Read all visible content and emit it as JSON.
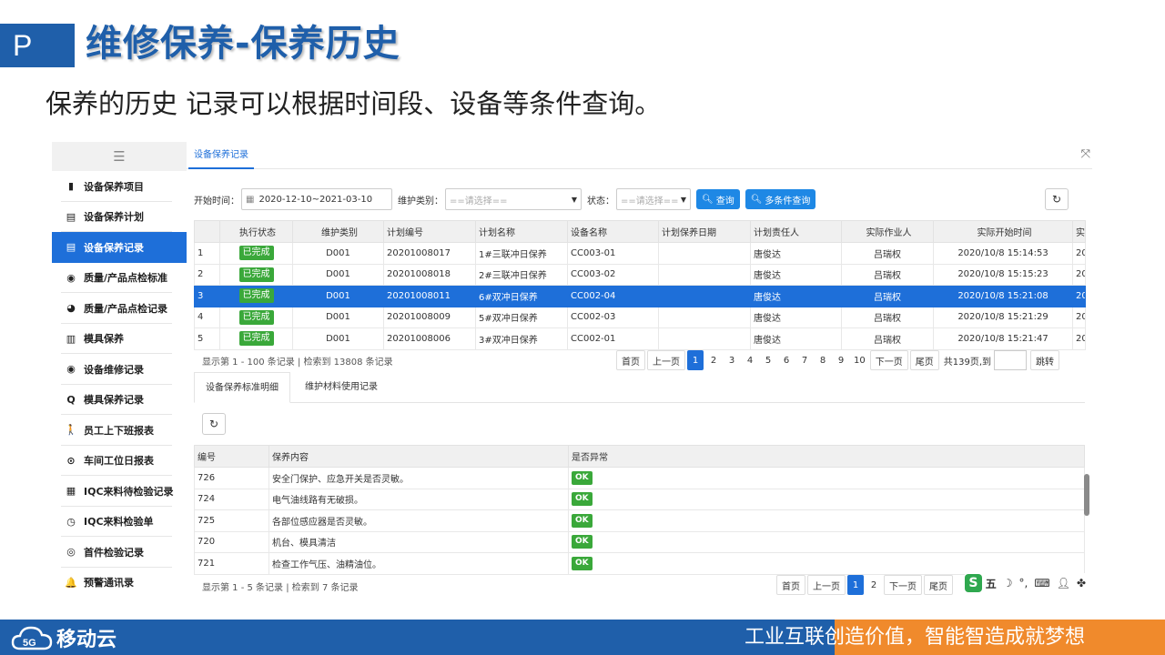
{
  "slide": {
    "badge": "P",
    "title": "维修保养-保养历史",
    "subtitle": "保养的历史 记录可以根据时间段、设备等条件查询。",
    "footer_slogan": "工业互联创造价值，智能智造成就梦想",
    "brand": "移动云",
    "brand_badge": "5G",
    "colors": {
      "primary": "#1f5faa",
      "accent": "#f08a2c",
      "active": "#1e6fd9",
      "success": "#3aa83a"
    }
  },
  "sidebar": {
    "toggle_icon": "menu-collapse-icon",
    "items": [
      {
        "label": "设备保养项目",
        "icon": "clipboard-icon",
        "glyph": "▮"
      },
      {
        "label": "设备保养计划",
        "icon": "id-card-icon",
        "glyph": "▤"
      },
      {
        "label": "设备保养记录",
        "icon": "id-card-icon",
        "glyph": "▤",
        "active": true
      },
      {
        "label": "质量/产品点检标准",
        "icon": "compass-icon",
        "glyph": "◉"
      },
      {
        "label": "质量/产品点检记录",
        "icon": "gauge-icon",
        "glyph": "◕"
      },
      {
        "label": "模具保养",
        "icon": "bar-chart-icon",
        "glyph": "▥"
      },
      {
        "label": "设备维修记录",
        "icon": "compass-icon",
        "glyph": "◉"
      },
      {
        "label": "模具保养记录",
        "icon": "search-icon",
        "glyph": "Q"
      },
      {
        "label": "员工上下班报表",
        "icon": "walking-icon",
        "glyph": "🚶"
      },
      {
        "label": "车间工位日报表",
        "icon": "target-icon",
        "glyph": "⊙"
      },
      {
        "label": "IQC来料待检验记录",
        "icon": "map-icon",
        "glyph": "▦"
      },
      {
        "label": "IQC来料检验单",
        "icon": "clock-icon",
        "glyph": "◷"
      },
      {
        "label": "首件检验记录",
        "icon": "eye-icon",
        "glyph": "◎"
      },
      {
        "label": "预警通讯录",
        "icon": "bell-icon",
        "glyph": "🔔"
      }
    ]
  },
  "tabs": {
    "active": "设备保养记录"
  },
  "filter": {
    "start_label": "开始时间：",
    "date_range": "2020-12-10~2021-03-10",
    "type_label": "维护类别：",
    "type_placeholder": "==请选择==",
    "status_label": "状态：",
    "status_placeholder": "==请选择==",
    "query_button": "查询",
    "multi_query_button": "多条件查询"
  },
  "records": {
    "columns": [
      "",
      "执行状态",
      "维护类别",
      "计划编号",
      "计划名称",
      "设备名称",
      "计划保养日期",
      "计划责任人",
      "实际作业人",
      "实际开始时间",
      "实"
    ],
    "rows": [
      {
        "idx": "1",
        "status": "已完成",
        "category": "D001",
        "plan_no": "20201008017",
        "plan_name": "1#三联冲日保养",
        "device": "CC003-01",
        "plan_date": "",
        "owner": "唐俊达",
        "worker": "吕瑞权",
        "start": "2020/10/8 15:14:53",
        "more": "20"
      },
      {
        "idx": "2",
        "status": "已完成",
        "category": "D001",
        "plan_no": "20201008018",
        "plan_name": "2#三联冲日保养",
        "device": "CC003-02",
        "plan_date": "",
        "owner": "唐俊达",
        "worker": "吕瑞权",
        "start": "2020/10/8 15:15:23",
        "more": "20"
      },
      {
        "idx": "3",
        "status": "已完成",
        "category": "D001",
        "plan_no": "20201008011",
        "plan_name": "6#双冲日保养",
        "device": "CC002-04",
        "plan_date": "",
        "owner": "唐俊达",
        "worker": "吕瑞权",
        "start": "2020/10/8 15:21:08",
        "more": "20",
        "selected": true
      },
      {
        "idx": "4",
        "status": "已完成",
        "category": "D001",
        "plan_no": "20201008009",
        "plan_name": "5#双冲日保养",
        "device": "CC002-03",
        "plan_date": "",
        "owner": "唐俊达",
        "worker": "吕瑞权",
        "start": "2020/10/8 15:21:29",
        "more": "20"
      },
      {
        "idx": "5",
        "status": "已完成",
        "category": "D001",
        "plan_no": "20201008006",
        "plan_name": "3#双冲日保养",
        "device": "CC002-01",
        "plan_date": "",
        "owner": "唐俊达",
        "worker": "吕瑞权",
        "start": "2020/10/8 15:21:47",
        "more": "20"
      }
    ],
    "pager_info": "显示第 1 - 100 条记录 | 检索到 13808 条记录",
    "pager": {
      "first": "首页",
      "prev": "上一页",
      "pages": [
        "1",
        "2",
        "3",
        "4",
        "5",
        "6",
        "7",
        "8",
        "9",
        "10"
      ],
      "current": "1",
      "next": "下一页",
      "last": "尾页",
      "total_text": "共139页,到",
      "jump": "跳转"
    }
  },
  "detail_tabs": [
    "设备保养标准明细",
    "维护材料使用记录"
  ],
  "details": {
    "columns": [
      "编号",
      "保养内容",
      "是否异常"
    ],
    "rows": [
      {
        "no": "726",
        "content": "安全门保护、应急开关是否灵敏。",
        "result": "OK"
      },
      {
        "no": "724",
        "content": "电气油线路有无破损。",
        "result": "OK"
      },
      {
        "no": "725",
        "content": "各部位感应器是否灵敏。",
        "result": "OK"
      },
      {
        "no": "720",
        "content": "机台、模具清洁",
        "result": "OK"
      },
      {
        "no": "721",
        "content": "检查工作气压、油精油位。",
        "result": "OK"
      }
    ],
    "pager_info": "显示第 1 - 5 条记录 | 检索到 7 条记录",
    "pager": {
      "first": "首页",
      "prev": "上一页",
      "pages": [
        "1",
        "2"
      ],
      "current": "1",
      "next": "下一页",
      "last": "尾页"
    }
  },
  "ime": {
    "logo": "S",
    "mode": "五"
  }
}
